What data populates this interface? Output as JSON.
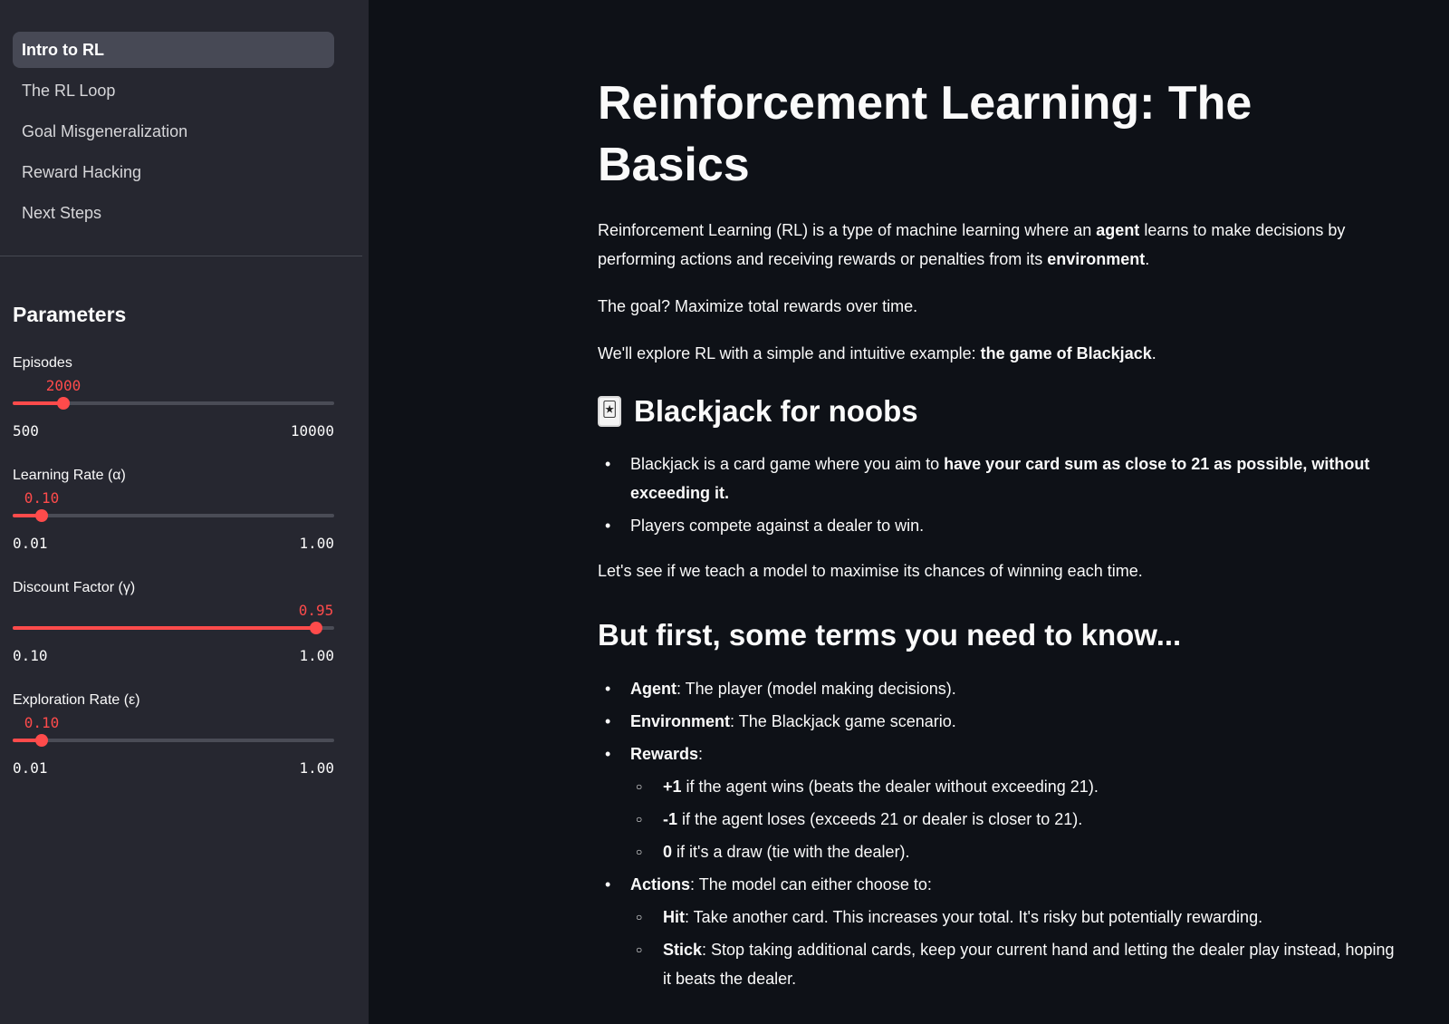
{
  "sidebar": {
    "nav": [
      {
        "label": "Intro to RL",
        "active": true
      },
      {
        "label": "The RL Loop",
        "active": false
      },
      {
        "label": "Goal Misgeneralization",
        "active": false
      },
      {
        "label": "Reward Hacking",
        "active": false
      },
      {
        "label": "Next Steps",
        "active": false
      }
    ],
    "params_title": "Parameters",
    "sliders": {
      "episodes": {
        "label": "Episodes",
        "value": "2000",
        "min": "500",
        "max": "10000",
        "fraction": 0.158
      },
      "learning_rate": {
        "label": "Learning Rate (α)",
        "value": "0.10",
        "min": "0.01",
        "max": "1.00",
        "fraction": 0.091
      },
      "discount": {
        "label": "Discount Factor (γ)",
        "value": "0.95",
        "min": "0.10",
        "max": "1.00",
        "fraction": 0.944
      },
      "exploration": {
        "label": "Exploration Rate (ε)",
        "value": "0.10",
        "min": "0.01",
        "max": "1.00",
        "fraction": 0.091
      }
    },
    "accent": "#ff4b4b"
  },
  "main": {
    "title": "Reinforcement Learning: The Basics",
    "intro": {
      "t1": "Reinforcement Learning (RL) is a type of machine learning where an ",
      "b1": "agent",
      "t2": " learns to make decisions by performing actions and receiving rewards or penalties from its ",
      "b2": "environment",
      "t3": "."
    },
    "goal": "The goal? Maximize total rewards over time.",
    "explore": {
      "t1": "We'll explore RL with a simple and intuitive example: ",
      "b1": "the game of Blackjack",
      "t2": "."
    },
    "blackjack_icon": "playing-card-icon",
    "blackjack_heading": "Blackjack for noobs",
    "bj_bullets": {
      "b1": {
        "t1": "Blackjack is a card game where you aim to ",
        "b1": "have your card sum as close to 21 as possible, without exceeding it."
      },
      "b2": "Players compete against a dealer to win."
    },
    "teach": "Let's see if we teach a model to maximise its chances of winning each time.",
    "terms_heading": "But first, some terms you need to know...",
    "terms": {
      "agent": {
        "b": "Agent",
        "t": ": The player (model making decisions)."
      },
      "environment": {
        "b": "Environment",
        "t": ": The Blackjack game scenario."
      },
      "rewards": {
        "b": "Rewards",
        "t": ":",
        "items": [
          {
            "b": "+1",
            "t": " if the agent wins (beats the dealer without exceeding 21)."
          },
          {
            "b": "-1",
            "t": " if the agent loses (exceeds 21 or dealer is closer to 21)."
          },
          {
            "b": "0",
            "t": " if it's a draw (tie with the dealer)."
          }
        ]
      },
      "actions": {
        "b": "Actions",
        "t": ": The model can either choose to:",
        "items": [
          {
            "b": "Hit",
            "t": ": Take another card. This increases your total. It's risky but potentially rewarding."
          },
          {
            "b": "Stick",
            "t": ": Stop taking additional cards, keep your current hand and letting the dealer play instead, hoping it beats the dealer."
          }
        ]
      }
    }
  }
}
